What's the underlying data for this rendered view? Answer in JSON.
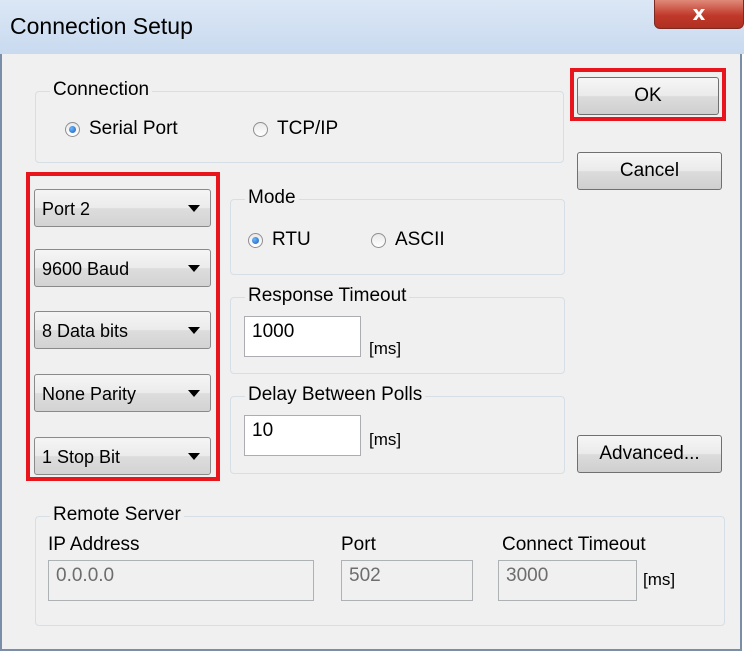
{
  "window": {
    "title": "Connection Setup",
    "close_glyph": "x"
  },
  "connection": {
    "label": "Connection",
    "options": [
      {
        "label": "Serial Port",
        "selected": true
      },
      {
        "label": "TCP/IP",
        "selected": false
      }
    ]
  },
  "buttons": {
    "ok": "OK",
    "cancel": "Cancel",
    "advanced": "Advanced..."
  },
  "serial_settings": {
    "port": "Port 2",
    "baud": "9600 Baud",
    "data_bits": "8 Data bits",
    "parity": "None Parity",
    "stop_bits": "1 Stop Bit"
  },
  "mode": {
    "label": "Mode",
    "options": [
      {
        "label": "RTU",
        "selected": true
      },
      {
        "label": "ASCII",
        "selected": false
      }
    ]
  },
  "response_timeout": {
    "label": "Response Timeout",
    "value": "1000",
    "unit": "[ms]"
  },
  "delay_between_polls": {
    "label": "Delay Between Polls",
    "value": "10",
    "unit": "[ms]"
  },
  "remote_server": {
    "label": "Remote Server",
    "ip_label": "IP Address",
    "ip_value": "0.0.0.0",
    "port_label": "Port",
    "port_value": "502",
    "timeout_label": "Connect Timeout",
    "timeout_value": "3000",
    "timeout_unit": "[ms]"
  },
  "colors": {
    "highlight": "#e8161c",
    "dialog_bg": "#f0f0f0",
    "close_button": "#c0392b"
  }
}
